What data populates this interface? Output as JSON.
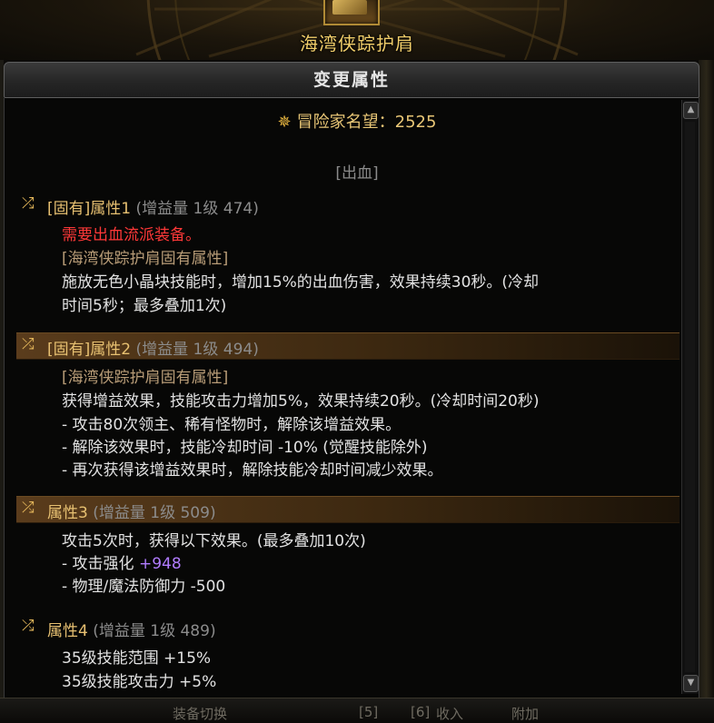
{
  "item": {
    "name": "海湾侠踪护肩",
    "icon": "shoulder-armor-icon"
  },
  "header": {
    "title": "变更属性"
  },
  "fame": {
    "icon": "fame-icon",
    "label": "冒险家名望：2525"
  },
  "category": "[出血]",
  "attributes": [
    {
      "title": "[固有]属性1",
      "detail": "(增益量 1级 474)",
      "highlighted": false,
      "lines": [
        {
          "text": "需要出血流派装备。",
          "style": "red"
        },
        {
          "text": "[海湾侠踪护肩固有属性]",
          "style": "tan"
        },
        {
          "text": "施放无色小晶块技能时，增加15%的出血伤害，效果持续30秒。(冷却",
          "style": "normal"
        },
        {
          "text": "时间5秒；最多叠加1次)",
          "style": "normal"
        }
      ]
    },
    {
      "title": "[固有]属性2",
      "detail": "(增益量 1级 494)",
      "highlighted": true,
      "lines": [
        {
          "text": "[海湾侠踪护肩固有属性]",
          "style": "tan"
        },
        {
          "text": "获得增益效果，技能攻击力增加5%，效果持续20秒。(冷却时间20秒)",
          "style": "normal"
        },
        {
          "text": "- 攻击80次领主、稀有怪物时，解除该增益效果。",
          "style": "normal"
        },
        {
          "text": "- 解除该效果时，技能冷却时间 -10% (觉醒技能除外)",
          "style": "normal"
        },
        {
          "text": "- 再次获得该增益效果时，解除技能冷却时间减少效果。",
          "style": "normal"
        }
      ]
    },
    {
      "title": "属性3",
      "detail": "(增益量 1级 509)",
      "highlighted": true,
      "lines": [
        {
          "text": "攻击5次时，获得以下效果。(最多叠加10次)",
          "style": "normal"
        },
        {
          "text": "- 攻击强化 ",
          "value": "+948",
          "style": "normal"
        },
        {
          "text": "- 物理/魔法防御力 -500",
          "style": "normal"
        }
      ]
    },
    {
      "title": "属性4",
      "detail": "(增益量 1级 489)",
      "highlighted": false,
      "lines": [
        {
          "text": "35级技能范围 +15%",
          "style": "normal"
        },
        {
          "text": "35级技能攻击力 +5%",
          "style": "normal"
        }
      ]
    }
  ],
  "bottom_bar": [
    "装备切换",
    "[5]",
    "[6]",
    "收入",
    "附加"
  ]
}
